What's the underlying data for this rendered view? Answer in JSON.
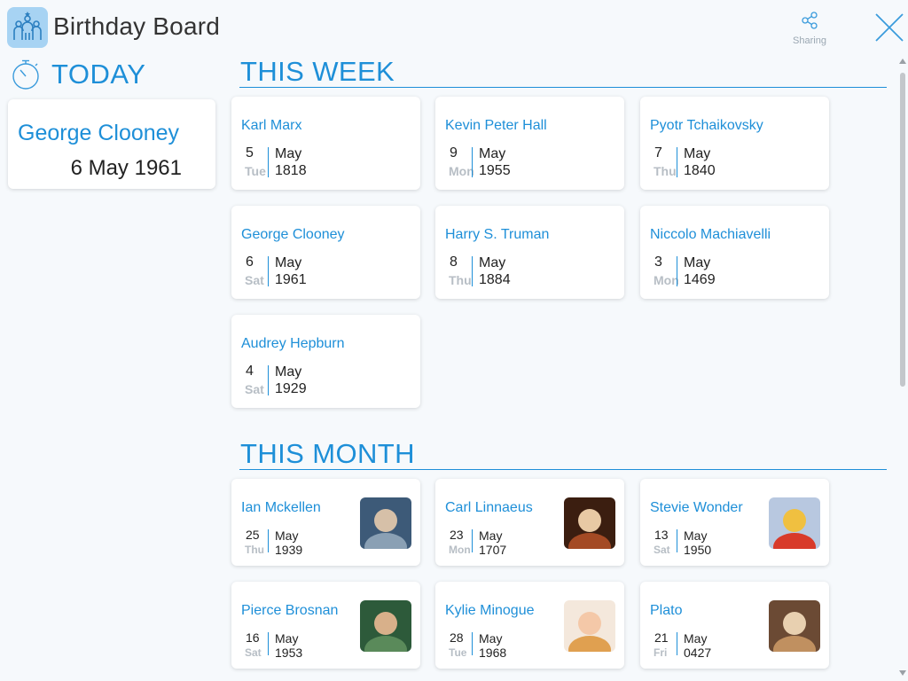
{
  "app": {
    "title": "Birthday Board",
    "icon": "people-party-icon"
  },
  "toolbar": {
    "sharing_label": "Sharing",
    "share_icon": "share-icon",
    "close_icon": "close-icon"
  },
  "today": {
    "heading": "TODAY",
    "icon": "stopwatch-icon",
    "name": "George Clooney",
    "date": "6 May 1961"
  },
  "this_week": {
    "heading": "THIS WEEK",
    "cards": [
      {
        "name": "Karl Marx",
        "day": "5",
        "weekday": "Tue",
        "month": "May",
        "year": "1818"
      },
      {
        "name": "Kevin Peter Hall",
        "day": "9",
        "weekday": "Mon",
        "month": "May",
        "year": "1955"
      },
      {
        "name": "Pyotr Tchaikovsky",
        "day": "7",
        "weekday": "Thu",
        "month": "May",
        "year": "1840"
      },
      {
        "name": "George Clooney",
        "day": "6",
        "weekday": "Sat",
        "month": "May",
        "year": "1961"
      },
      {
        "name": "Harry S. Truman",
        "day": "8",
        "weekday": "Thu",
        "month": "May",
        "year": "1884"
      },
      {
        "name": "Niccolo Machiavelli",
        "day": "3",
        "weekday": "Mon",
        "month": "May",
        "year": "1469"
      },
      {
        "name": "Audrey Hepburn",
        "day": "4",
        "weekday": "Sat",
        "month": "May",
        "year": "1929"
      }
    ]
  },
  "this_month": {
    "heading": "THIS MONTH",
    "cards": [
      {
        "name": "Ian Mckellen",
        "day": "25",
        "weekday": "Thu",
        "month": "May",
        "year": "1939",
        "photo": "portrait-photo"
      },
      {
        "name": "Carl Linnaeus",
        "day": "23",
        "weekday": "Mon",
        "month": "May",
        "year": "1707",
        "photo": "portrait-photo"
      },
      {
        "name": "Stevie Wonder",
        "day": "13",
        "weekday": "Sat",
        "month": "May",
        "year": "1950",
        "photo": "portrait-photo"
      },
      {
        "name": "Pierce Brosnan",
        "day": "16",
        "weekday": "Sat",
        "month": "May",
        "year": "1953",
        "photo": "portrait-photo"
      },
      {
        "name": "Kylie Minogue",
        "day": "28",
        "weekday": "Tue",
        "month": "May",
        "year": "1968",
        "photo": "portrait-photo"
      },
      {
        "name": "Plato",
        "day": "21",
        "weekday": "Fri",
        "month": "May",
        "year": "0427",
        "photo": "portrait-photo"
      }
    ]
  },
  "colors": {
    "accent": "#1e8fd8",
    "background": "#f6f9fc",
    "weekday": "#b7bec5"
  }
}
